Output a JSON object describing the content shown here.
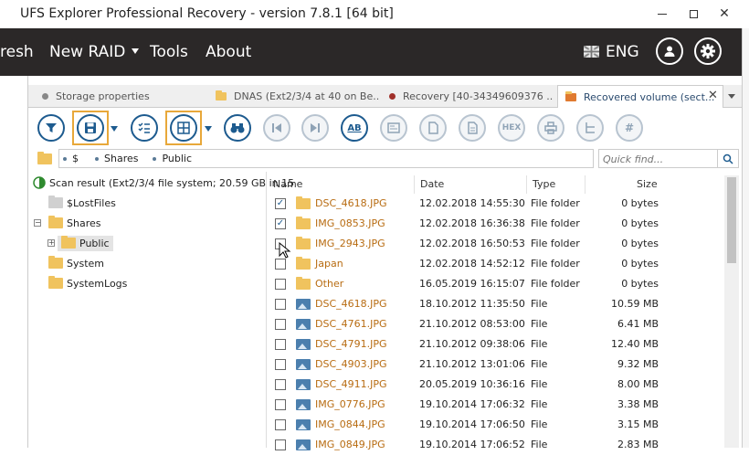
{
  "window": {
    "title": "UFS Explorer Professional Recovery - version 7.8.1 [64 bit]"
  },
  "menu": {
    "items": [
      "resh",
      "New RAID",
      "Tools",
      "About"
    ],
    "language": "ENG"
  },
  "tabs": [
    {
      "label": "Storage properties",
      "dot_color": "#888888"
    },
    {
      "label": "DNAS (Ext2/3/4 at 40 on Be...",
      "dot_color": "#f0c35e"
    },
    {
      "label": "Recovery [40-34349609376 ...",
      "dot_color": "#a0302a"
    },
    {
      "label": "Recovered volume (sect...",
      "dot_color": "#e07a30"
    }
  ],
  "path": {
    "segments": [
      "$",
      "Shares",
      "Public"
    ]
  },
  "search": {
    "placeholder": "Quick find..."
  },
  "tree": {
    "root": "Scan result (Ext2/3/4 file system; 20.59 GB in 15",
    "items": [
      "$LostFiles",
      "Shares",
      "Public",
      "System",
      "SystemLogs"
    ]
  },
  "list": {
    "headers": {
      "name": "Name",
      "date": "Date",
      "type": "Type",
      "size": "Size"
    },
    "rows": [
      {
        "checked": true,
        "kind": "folder",
        "name": "DSC_4618.JPG",
        "date": "12.02.2018 14:55:30",
        "type": "File folder",
        "size": "0 bytes"
      },
      {
        "checked": true,
        "kind": "folder",
        "name": "IMG_0853.JPG",
        "date": "12.02.2018 16:36:38",
        "type": "File folder",
        "size": "0 bytes"
      },
      {
        "checked": false,
        "kind": "folder",
        "name": "IMG_2943.JPG",
        "date": "12.02.2018 16:50:53",
        "type": "File folder",
        "size": "0 bytes"
      },
      {
        "checked": false,
        "kind": "folder",
        "name": "Japan",
        "date": "12.02.2018 14:52:12",
        "type": "File folder",
        "size": "0 bytes"
      },
      {
        "checked": false,
        "kind": "folder",
        "name": "Other",
        "date": "16.05.2019 16:15:07",
        "type": "File folder",
        "size": "0 bytes"
      },
      {
        "checked": false,
        "kind": "image",
        "name": "DSC_4618.JPG",
        "date": "18.10.2012 11:35:50",
        "type": "File",
        "size": "10.59 MB"
      },
      {
        "checked": false,
        "kind": "image",
        "name": "DSC_4761.JPG",
        "date": "21.10.2012 08:53:00",
        "type": "File",
        "size": "6.41 MB"
      },
      {
        "checked": false,
        "kind": "image",
        "name": "DSC_4791.JPG",
        "date": "21.10.2012 09:38:06",
        "type": "File",
        "size": "12.40 MB"
      },
      {
        "checked": false,
        "kind": "image",
        "name": "DSC_4903.JPG",
        "date": "21.10.2012 13:01:06",
        "type": "File",
        "size": "9.32 MB"
      },
      {
        "checked": false,
        "kind": "image",
        "name": "DSC_4911.JPG",
        "date": "20.05.2019 10:36:16",
        "type": "File",
        "size": "8.00 MB"
      },
      {
        "checked": false,
        "kind": "image",
        "name": "IMG_0776.JPG",
        "date": "19.10.2014 17:06:32",
        "type": "File",
        "size": "3.38 MB"
      },
      {
        "checked": false,
        "kind": "image",
        "name": "IMG_0844.JPG",
        "date": "19.10.2014 17:06:50",
        "type": "File",
        "size": "3.15 MB"
      },
      {
        "checked": false,
        "kind": "image",
        "name": "IMG_0849.JPG",
        "date": "19.10.2014 17:06:52",
        "type": "File",
        "size": "2.83 MB"
      }
    ]
  },
  "toolbar": {
    "hex_label": "HEX",
    "spell_label": "AB",
    "hash_label": "#"
  },
  "colors": {
    "accent": "#1d5b8f",
    "highlight": "#e8a83a",
    "menu_bg": "#2b2828"
  }
}
